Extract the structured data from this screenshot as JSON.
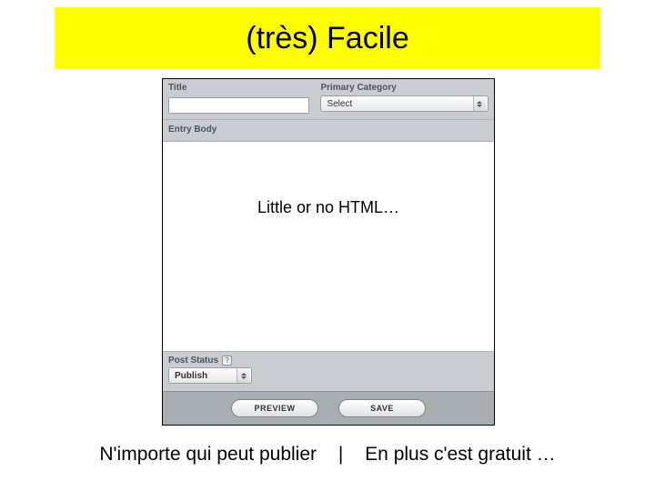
{
  "banner": {
    "title": "(très) Facile"
  },
  "editor": {
    "title_label": "Title",
    "title_value": "",
    "category_label": "Primary Category",
    "category_selected": "Select",
    "entry_body_label": "Entry Body",
    "post_status_label": "Post Status",
    "post_status_value": "Publish",
    "preview_button": "PREVIEW",
    "save_button": "SAVE"
  },
  "overlay": {
    "caption": "Little or no HTML…"
  },
  "footer": {
    "left": "N'importe qui peut publier",
    "sep": "|",
    "right": "En plus c'est gratuit …"
  }
}
